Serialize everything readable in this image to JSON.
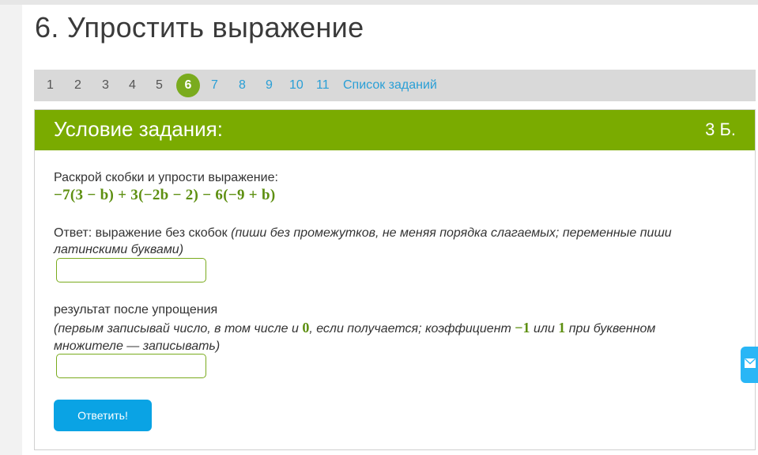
{
  "page_title": "6. Упростить выражение",
  "pager": {
    "pages": [
      "1",
      "2",
      "3",
      "4",
      "5",
      "6",
      "7",
      "8",
      "9",
      "10",
      "11"
    ],
    "active": "6",
    "list_link": "Список заданий"
  },
  "card": {
    "title": "Условие задания:",
    "points": "3 Б.",
    "instruction": "Раскрой скобки и упрости выражение:",
    "expression": "−7(3 − b) + 3(−2b − 2) − 6(−9 + b)",
    "answer_label": "Ответ: выражение без скобок",
    "answer_hint": "(пиши без промежутков, не меняя порядка слагаемых; переменные пиши латинскими буквами)",
    "answer_value": "",
    "result_label": "результат после упрощения",
    "result_hint_part1": "(первым записывай число, в том числе и",
    "result_hint_zero": "0",
    "result_hint_part2": ", если получается; коэффициент",
    "result_hint_minus_one": "−1",
    "result_hint_or": "или",
    "result_hint_one": "1",
    "result_hint_part3": "при буквенном множителе — записывать)",
    "result_value": "",
    "submit_label": "Ответить!"
  },
  "colors": {
    "accent_green": "#7aab00",
    "math_green": "#5d8f10",
    "link_blue": "#2a9fd6",
    "button_blue": "#0aa3e4"
  },
  "icons": {
    "side_tab": "envelope-icon"
  }
}
